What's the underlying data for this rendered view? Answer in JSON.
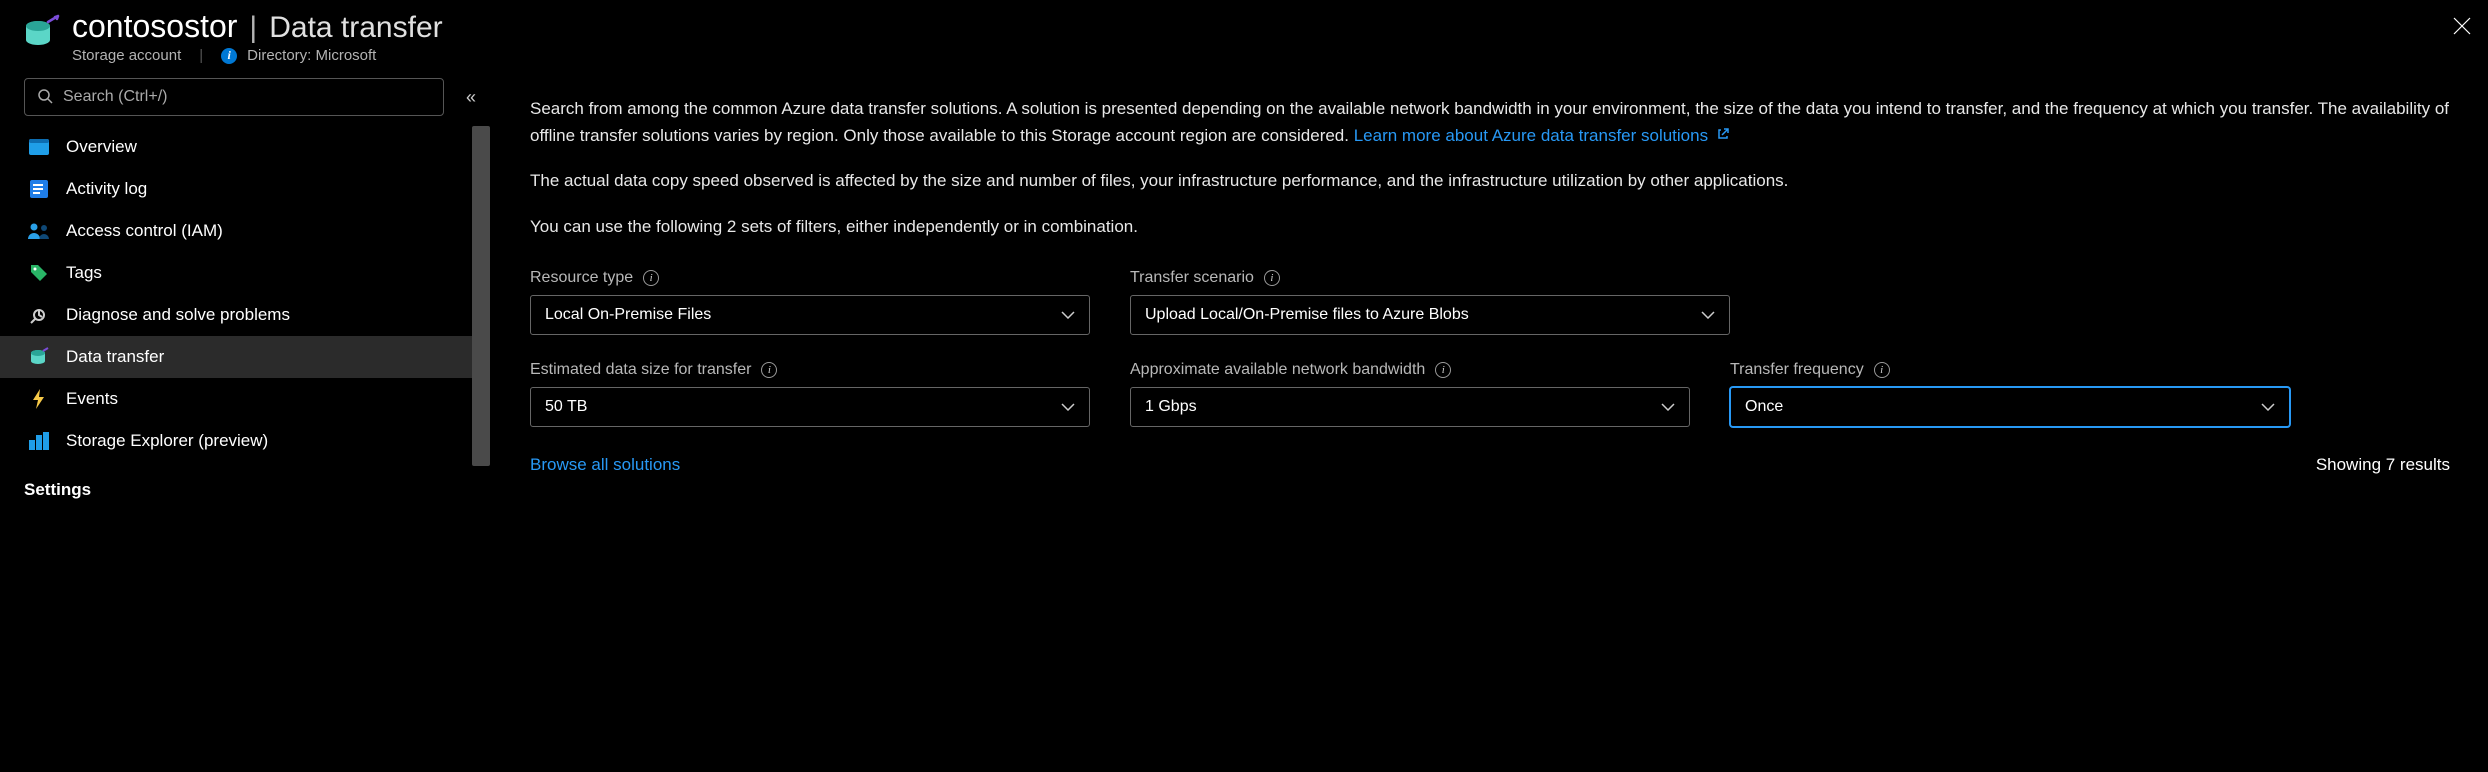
{
  "header": {
    "resource_name": "contosostor",
    "page_title": "Data transfer",
    "resource_type": "Storage account",
    "directory_label": "Directory: Microsoft"
  },
  "search": {
    "placeholder": "Search (Ctrl+/)"
  },
  "nav": {
    "items": [
      {
        "label": "Overview"
      },
      {
        "label": "Activity log"
      },
      {
        "label": "Access control (IAM)"
      },
      {
        "label": "Tags"
      },
      {
        "label": "Diagnose and solve problems"
      },
      {
        "label": "Data transfer"
      },
      {
        "label": "Events"
      },
      {
        "label": "Storage Explorer (preview)"
      }
    ],
    "section_header": "Settings"
  },
  "intro": {
    "p1a": "Search from among the common Azure data transfer solutions. A solution is presented depending on the available network bandwidth in your environment, the size of the data you intend to transfer, and the frequency at which you transfer. The availability of offline transfer solutions varies by region. Only those available to this Storage account region are considered. ",
    "link1": "Learn more about Azure data transfer solutions",
    "p2": "The actual data copy speed observed is affected by the size and number of files, your infrastructure performance, and the infrastructure utilization by other applications.",
    "p3": "You can use the following 2 sets of filters, either independently or in combination."
  },
  "filters": {
    "resource_type": {
      "label": "Resource type",
      "value": "Local On-Premise Files"
    },
    "transfer_scenario": {
      "label": "Transfer scenario",
      "value": "Upload Local/On-Premise files to Azure Blobs"
    },
    "data_size": {
      "label": "Estimated data size for transfer",
      "value": "50 TB"
    },
    "bandwidth": {
      "label": "Approximate available network bandwidth",
      "value": "1 Gbps"
    },
    "frequency": {
      "label": "Transfer frequency",
      "value": "Once"
    }
  },
  "footer": {
    "browse_all": "Browse all solutions",
    "results": "Showing 7 results"
  }
}
